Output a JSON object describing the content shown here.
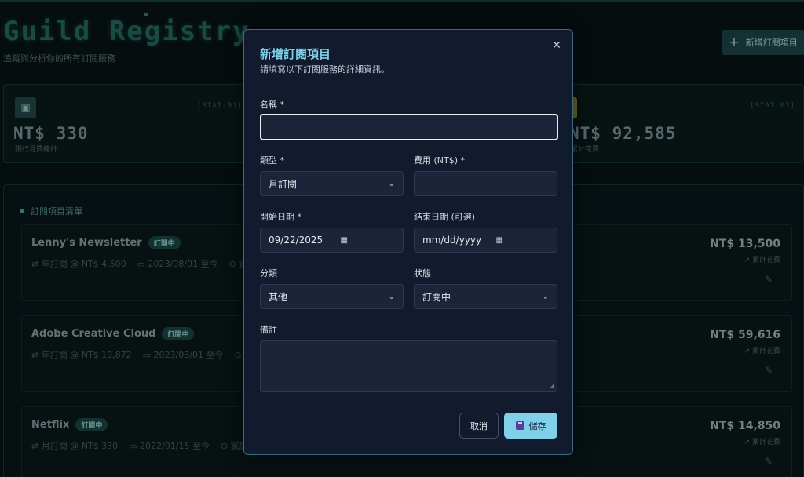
{
  "page": {
    "title": "Guild Registry",
    "subtitle": "追蹤與分析你的所有訂閱服務",
    "add_button": "新增訂閱項目"
  },
  "stats": [
    {
      "tag": "[STAT-01]",
      "value": "NT$ 330",
      "label": "現行月費總計"
    },
    {
      "tag": "[STAT-03]",
      "value": "NT$ 92,585",
      "label": "累計花費"
    }
  ],
  "list": {
    "title": "訂閱項目清單",
    "items": [
      {
        "name": "Lenny's Newsletter",
        "status": "訂閱中",
        "plan": "年訂閱 @ NT$ 4,500",
        "start": "2023/08/01 至今",
        "extra": "⊙ 資",
        "total": "NT$ 13,500",
        "total_label": "累計花費"
      },
      {
        "name": "Adobe Creative Cloud",
        "status": "訂閱中",
        "plan": "年訂閱 @ NT$ 19,872",
        "start": "2023/03/01 至今",
        "extra": "⊙ 創",
        "total": "NT$ 59,616",
        "total_label": "累計花費"
      },
      {
        "name": "Netflix",
        "status": "訂閱中",
        "plan": "月訂閱 @ NT$ 330",
        "start": "2022/01/15 至今",
        "extra": "⊙ 家庭",
        "total": "NT$ 14,850",
        "total_label": "累計花費"
      }
    ]
  },
  "modal": {
    "title": "新增訂閱項目",
    "description": "請填寫以下訂閱服務的詳細資訊。",
    "fields": {
      "name_label": "名稱 *",
      "name_value": "",
      "type_label": "類型 *",
      "type_value": "月訂閱",
      "cost_label": "費用 (NT$) *",
      "cost_value": "",
      "start_label": "開始日期 *",
      "start_value": "09/22/2025",
      "end_label": "結束日期 (可選)",
      "end_value": "mm/dd/yyyy",
      "category_label": "分類",
      "category_value": "其他",
      "status_label": "狀態",
      "status_value": "訂閱中",
      "notes_label": "備註"
    },
    "cancel": "取消",
    "save": "儲存"
  },
  "colors": {
    "accent": "#7fd0e8",
    "modal_bg": "#121b2e",
    "page_bg": "#071012"
  }
}
